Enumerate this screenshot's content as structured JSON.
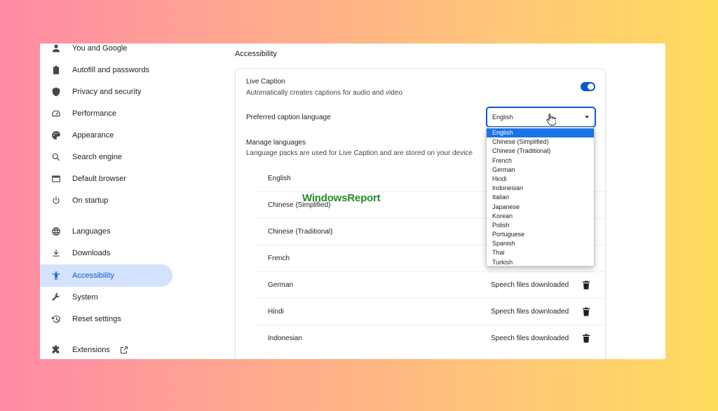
{
  "sidebar": {
    "items": [
      {
        "label": "You and Google",
        "icon": "person-icon"
      },
      {
        "label": "Autofill and passwords",
        "icon": "clipboard-icon"
      },
      {
        "label": "Privacy and security",
        "icon": "shield-icon"
      },
      {
        "label": "Performance",
        "icon": "speedometer-icon"
      },
      {
        "label": "Appearance",
        "icon": "palette-icon"
      },
      {
        "label": "Search engine",
        "icon": "search-icon"
      },
      {
        "label": "Default browser",
        "icon": "browser-window-icon"
      },
      {
        "label": "On startup",
        "icon": "power-icon"
      },
      {
        "label": "Languages",
        "icon": "globe-icon"
      },
      {
        "label": "Downloads",
        "icon": "download-icon"
      },
      {
        "label": "Accessibility",
        "icon": "accessibility-icon"
      },
      {
        "label": "System",
        "icon": "wrench-icon"
      },
      {
        "label": "Reset settings",
        "icon": "history-icon"
      },
      {
        "label": "Extensions",
        "icon": "puzzle-icon"
      }
    ],
    "active": "Accessibility"
  },
  "main": {
    "section_title": "Accessibility",
    "live_caption": {
      "title": "Live Caption",
      "description": "Automatically creates captions for audio and video",
      "enabled": true
    },
    "preferred_language": {
      "label": "Preferred caption language",
      "selected": "English",
      "options": [
        "English",
        "Chinese (Simplified)",
        "Chinese (Traditional)",
        "French",
        "German",
        "Hindi",
        "Indonesian",
        "Italian",
        "Japanese",
        "Korean",
        "Polish",
        "Portuguese",
        "Spanish",
        "Thai",
        "Turkish"
      ]
    },
    "manage_languages": {
      "title": "Manage languages",
      "description": "Language packs are used for Live Caption and are stored on your device"
    },
    "languages": [
      {
        "name": "English",
        "status": ""
      },
      {
        "name": "Chinese (Simplified)",
        "status": ""
      },
      {
        "name": "Chinese (Traditional)",
        "status": ""
      },
      {
        "name": "French",
        "status": ""
      },
      {
        "name": "German",
        "status": "Speech files downloaded"
      },
      {
        "name": "Hindi",
        "status": "Speech files downloaded"
      },
      {
        "name": "Indonesian",
        "status": "Speech files downloaded"
      }
    ]
  },
  "watermark": "WindowsReport",
  "colors": {
    "accent": "#0b57d0",
    "active_bg": "#d3e3fd",
    "watermark": "#2a8a2a"
  }
}
